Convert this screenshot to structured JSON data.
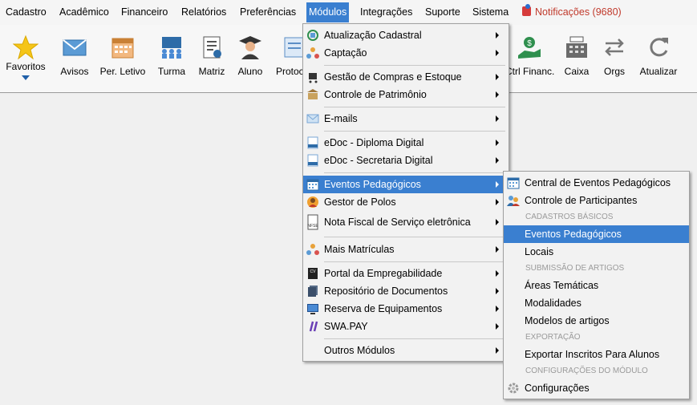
{
  "menubar": {
    "items": [
      "Cadastro",
      "Acadêmico",
      "Financeiro",
      "Relatórios",
      "Preferências",
      "Módulos",
      "Integrações",
      "Suporte",
      "Sistema"
    ],
    "notifications": "Notificações (9680)"
  },
  "toolbar": {
    "buttons": [
      "Favoritos",
      "Avisos",
      "Per. Letivo",
      "Turma",
      "Matriz",
      "Aluno",
      "Protoc",
      "Ctrl Financ.",
      "Caixa",
      "Orgs",
      "Atualizar"
    ]
  },
  "modulos_menu": {
    "items": [
      {
        "label": "Atualização Cadastral",
        "icon": "refresh-doc-icon"
      },
      {
        "label": "Captação",
        "icon": "people-network-icon"
      },
      {
        "label": "Gestão de Compras e Estoque",
        "icon": "shopping-cart-icon"
      },
      {
        "label": "Controle de Patrimônio",
        "icon": "building-icon"
      },
      {
        "label": "E-mails",
        "icon": "envelope-icon"
      },
      {
        "label": "eDoc - Diploma Digital",
        "icon": "edoc-icon"
      },
      {
        "label": "eDoc - Secretaria Digital",
        "icon": "edoc-icon"
      },
      {
        "label": "Eventos Pedagógicos",
        "icon": "calendar-icon"
      },
      {
        "label": "Gestor de Polos",
        "icon": "user-circle-icon"
      },
      {
        "label": "Nota Fiscal de Serviço eletrônica",
        "icon": "nfse-icon"
      },
      {
        "label": "Mais Matrículas",
        "icon": "people-network-icon"
      },
      {
        "label": "Portal da Empregabilidade",
        "icon": "cv-icon"
      },
      {
        "label": "Repositório de Documentos",
        "icon": "documents-icon"
      },
      {
        "label": "Reserva de Equipamentos",
        "icon": "monitor-icon"
      },
      {
        "label": "SWA.PAY",
        "icon": "swapay-icon"
      },
      {
        "label": "Outros Módulos",
        "icon": ""
      }
    ]
  },
  "eventos_submenu": {
    "central": "Central de Eventos Pedagógicos",
    "controle": "Controle de Participantes",
    "head_cadastros": "CADASTROS BÁSICOS",
    "eventos": "Eventos Pedagógicos",
    "locais": "Locais",
    "head_submissao": "SUBMISSÃO DE ARTIGOS",
    "areas": "Áreas Temáticas",
    "modalidades": "Modalidades",
    "modelos": "Modelos de artigos",
    "head_exportacao": "EXPORTAÇÃO",
    "exportar": "Exportar Inscritos Para Alunos",
    "head_config": "CONFIGURAÇÕES DO MÓDULO",
    "configuracoes": "Configurações"
  }
}
